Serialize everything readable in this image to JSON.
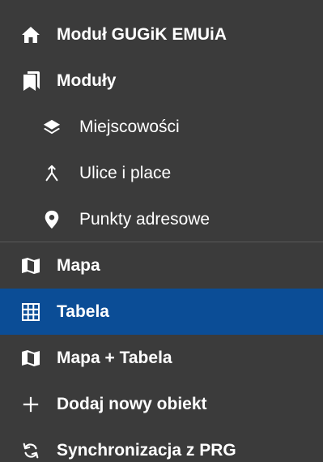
{
  "sidebar": {
    "items": [
      {
        "label": "Moduł GUGiK EMUiA",
        "icon": "home-icon"
      },
      {
        "label": "Moduły",
        "icon": "bookmark-icon"
      },
      {
        "label": "Miejscowości",
        "icon": "layers-icon"
      },
      {
        "label": "Ulice i place",
        "icon": "road-merge-icon"
      },
      {
        "label": "Punkty adresowe",
        "icon": "map-marker-icon"
      },
      {
        "label": "Mapa",
        "icon": "map-icon"
      },
      {
        "label": "Tabela",
        "icon": "table-icon"
      },
      {
        "label": "Mapa + Tabela",
        "icon": "map-icon"
      },
      {
        "label": "Dodaj nowy obiekt",
        "icon": "plus-icon"
      },
      {
        "label": "Synchronizacja z PRG",
        "icon": "sync-icon"
      }
    ],
    "active_item": "Tabela",
    "colors": {
      "background": "#3b3b3b",
      "active_background": "#0b4d96",
      "text": "#ffffff"
    }
  }
}
